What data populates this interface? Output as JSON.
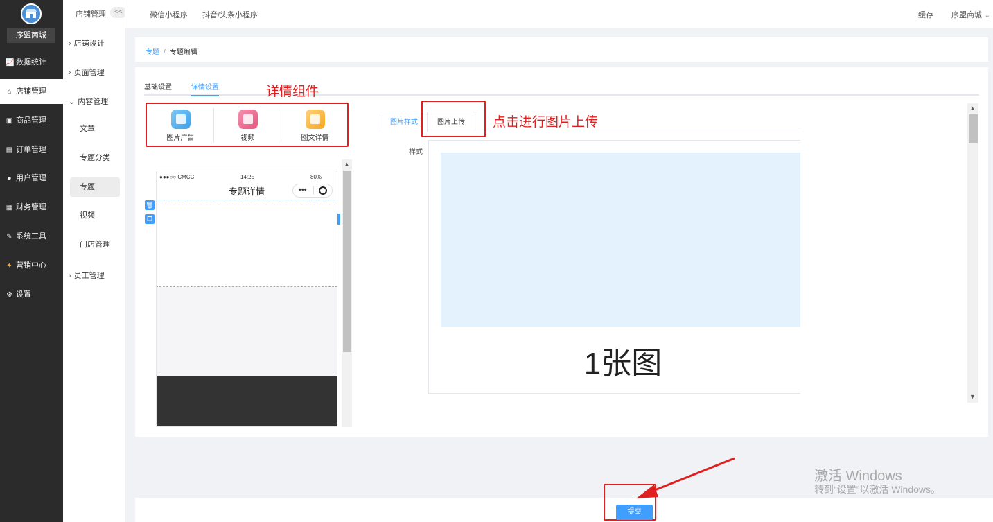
{
  "sidebar": {
    "shop_name": "序盟商城",
    "items": [
      {
        "icon": "chart-icon",
        "label": "数据统计"
      },
      {
        "icon": "store-icon",
        "label": "店铺管理"
      },
      {
        "icon": "goods-icon",
        "label": "商品管理"
      },
      {
        "icon": "order-icon",
        "label": "订单管理"
      },
      {
        "icon": "user-icon",
        "label": "用户管理"
      },
      {
        "icon": "finance-icon",
        "label": "财务管理"
      },
      {
        "icon": "wrench-icon",
        "label": "系统工具"
      },
      {
        "icon": "marketing-icon",
        "label": "营销中心"
      },
      {
        "icon": "gear-icon",
        "label": "设置"
      }
    ],
    "active": "店铺管理"
  },
  "subnav": {
    "title": "店铺管理",
    "collapse_label": "<<",
    "items": [
      "店铺设计",
      "页面管理",
      "内容管理",
      "员工管理"
    ],
    "children": [
      "文章",
      "专题分类",
      "专题",
      "视频",
      "门店管理"
    ]
  },
  "topbar": {
    "tabs": [
      "微信小程序",
      "抖音/头条小程序"
    ],
    "cache": "缓存",
    "shop": "序盟商城"
  },
  "breadcrumb": {
    "parent": "专题",
    "sep": "/",
    "current": "专题编辑"
  },
  "main": {
    "tabs": [
      "基础设置",
      "详情设置"
    ],
    "components": [
      "图片广告",
      "视频",
      "图文详情"
    ],
    "annotation_components": "详情组件",
    "annotation_upload": "点击进行图片上传"
  },
  "phone": {
    "carrier": "●●●○○ CMCC",
    "time": "14:25",
    "battery": "80%",
    "title": "专题详情"
  },
  "editor": {
    "subtabs": [
      "图片样式",
      "图片上传"
    ],
    "style_label": "样式",
    "preview_text": "1张图"
  },
  "footer": {
    "submit": "提交"
  },
  "watermark": {
    "line1": "激活 Windows",
    "line2": "转到“设置”以激活 Windows。"
  },
  "colors": {
    "primary": "#409eff",
    "sidebar": "#2b2b2b",
    "annotation": "#e02020"
  }
}
